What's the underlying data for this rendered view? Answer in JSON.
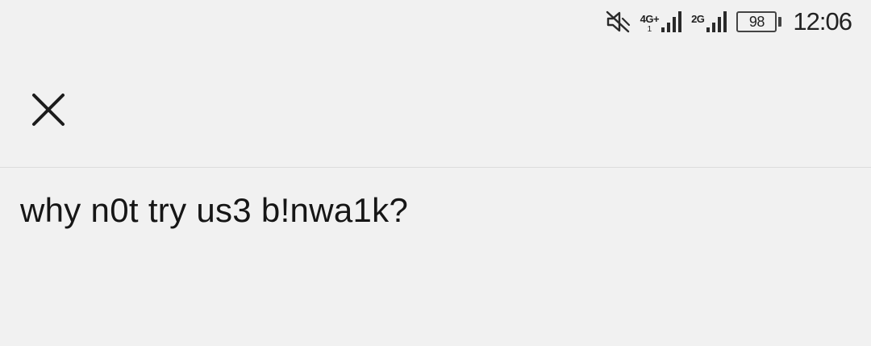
{
  "status_bar": {
    "sim1_network": "4G+",
    "sim1_sub": "1",
    "sim2_network": "2G",
    "battery_level": "98",
    "battery_fraction": 0.98,
    "time": "12:06",
    "icons": [
      "muted-icon",
      "signal-sim1-icon",
      "signal-sim2-icon",
      "battery-icon"
    ]
  },
  "header": {
    "close_icon": "close-icon"
  },
  "content": {
    "message": "why n0t try us3 b!nwa1k?"
  },
  "colors": {
    "background": "#f1f1f1",
    "text": "#161616",
    "divider": "#dcdcdc"
  }
}
